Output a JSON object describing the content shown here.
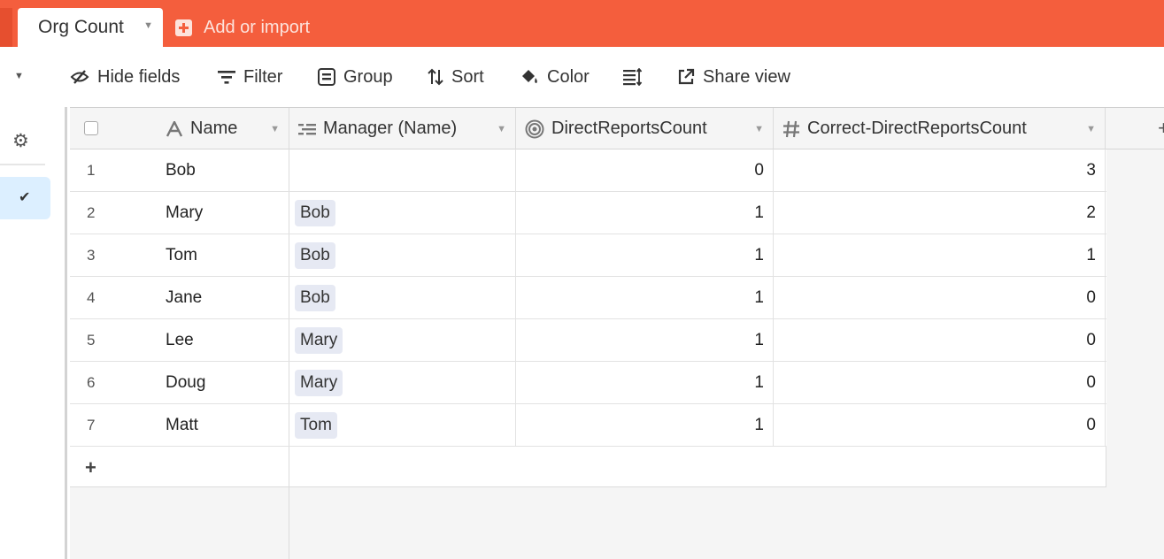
{
  "tabs": {
    "active_label": "Org Count",
    "add_label": "Add or import"
  },
  "toolbar": {
    "hide_fields": "Hide fields",
    "filter": "Filter",
    "group": "Group",
    "sort": "Sort",
    "color": "Color",
    "share_view": "Share view"
  },
  "columns": {
    "name": "Name",
    "manager": "Manager (Name)",
    "direct_reports": "DirectReportsCount",
    "correct_direct_reports": "Correct-DirectReportsCount"
  },
  "rows": [
    {
      "num": "1",
      "name": "Bob",
      "manager": "",
      "count": "0",
      "correct": "3"
    },
    {
      "num": "2",
      "name": "Mary",
      "manager": "Bob",
      "count": "1",
      "correct": "2"
    },
    {
      "num": "3",
      "name": "Tom",
      "manager": "Bob",
      "count": "1",
      "correct": "1"
    },
    {
      "num": "4",
      "name": "Jane",
      "manager": "Bob",
      "count": "1",
      "correct": "0"
    },
    {
      "num": "5",
      "name": "Lee",
      "manager": "Mary",
      "count": "1",
      "correct": "0"
    },
    {
      "num": "6",
      "name": "Doug",
      "manager": "Mary",
      "count": "1",
      "correct": "0"
    },
    {
      "num": "7",
      "name": "Matt",
      "manager": "Tom",
      "count": "1",
      "correct": "0"
    }
  ],
  "colors": {
    "brand": "#f45e3d",
    "selected_view": "#dcefff",
    "chip": "#e6e9f3"
  }
}
